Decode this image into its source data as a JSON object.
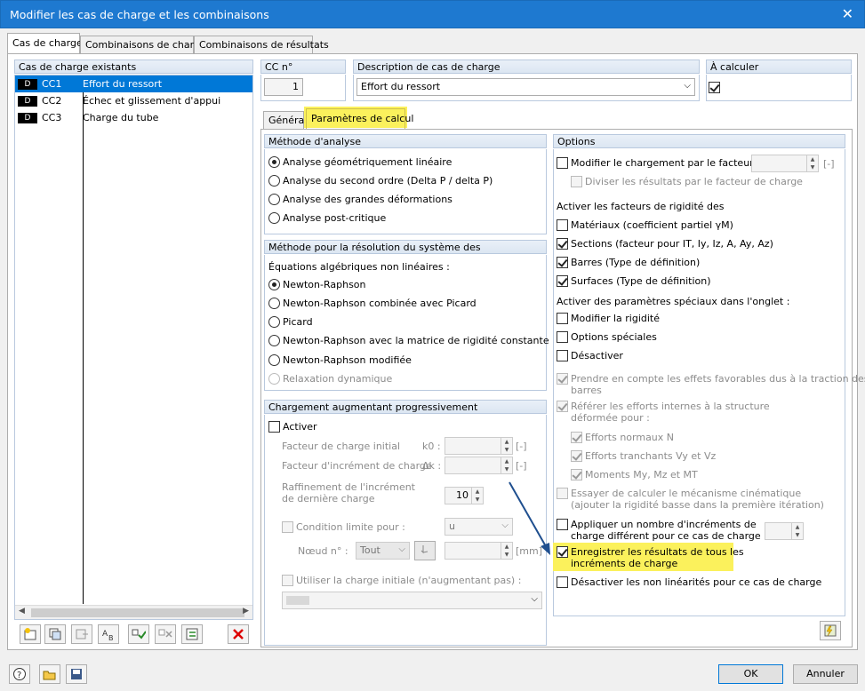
{
  "window": {
    "title": "Modifier les cas de charge et les combinaisons",
    "close": "✕"
  },
  "tabs": [
    "Cas de charge",
    "Combinaisons de charge",
    "Combinaisons de résultats"
  ],
  "list": {
    "header": "Cas de charge existants",
    "items": [
      {
        "type": "D",
        "id": "CC1",
        "name": "Effort du ressort"
      },
      {
        "type": "D",
        "id": "CC2",
        "name": "Échec et glissement d'appui"
      },
      {
        "type": "D",
        "id": "CC3",
        "name": "Charge du tube"
      }
    ]
  },
  "cc": {
    "label": "CC n°",
    "value": "1"
  },
  "desc": {
    "label": "Description de cas de charge",
    "value": "Effort du ressort"
  },
  "calc": {
    "label": "À calculer"
  },
  "subtabs": [
    "Général",
    "Paramètres de calcul"
  ],
  "analysis": {
    "title": "Méthode d'analyse",
    "options": [
      "Analyse géométriquement linéaire",
      "Analyse du second ordre (Delta P / delta P)",
      "Analyse des grandes déformations",
      "Analyse post-critique"
    ]
  },
  "solver": {
    "title": "Méthode pour la résolution du système des",
    "sub": "Équations algébriques non linéaires :",
    "options": [
      "Newton-Raphson",
      "Newton-Raphson combinée avec Picard",
      "Picard",
      "Newton-Raphson avec la matrice de rigidité constante",
      "Newton-Raphson modifiée",
      "Relaxation dynamique"
    ]
  },
  "prog": {
    "title": "Chargement augmentant progressivement",
    "activate": "Activer",
    "f1": "Facteur de charge initial",
    "f1s": "k0 :",
    "f2": "Facteur d'incrément de charge",
    "f2s": "Δk :",
    "unit": "[-]",
    "refine": "Raffinement de l'incrément de dernière charge",
    "refine_val": "10",
    "cond": "Condition limite pour :",
    "cond_val": "u",
    "node": "Nœud n° :",
    "node_val": "Tout",
    "mm": "[mm]",
    "initial": "Utiliser la charge initiale (n'augmentant pas) :"
  },
  "options": {
    "title": "Options",
    "modify": "Modifier le chargement par le facteur :",
    "unit": "[-]",
    "divide": "Diviser les résultats par le facteur de charge",
    "rig_head": "Activer les facteurs de rigidité des",
    "materials": "Matériaux (coefficient partiel γM)",
    "sections": "Sections (facteur pour IT, Iy, Iz, A, Ay, Az)",
    "bars": "Barres (Type de définition)",
    "surfaces": "Surfaces (Type de définition)",
    "spec_head": "Activer des paramètres spéciaux dans l'onglet :",
    "modrig": "Modifier la rigidité",
    "specopt": "Options spéciales",
    "deact": "Désactiver",
    "favorable1": "Prendre en compte les effets favorables dus à la traction des",
    "favorable2": "barres",
    "ref1": "Référer les efforts internes à la structure",
    "ref2": "déformée pour :",
    "normal": "Efforts normaux N",
    "shear": "Efforts tranchants Vy et Vz",
    "moments": "Moments My, Mz et MT",
    "mech1": "Essayer de calculer le mécanisme cinématique",
    "mech2": "(ajouter la rigidité basse dans la première itération)",
    "apply1": "Appliquer un nombre d'incréments de",
    "apply2": "charge différent pour ce cas de charge :",
    "save1": "Enregistrer les résultats de tous les",
    "save2": "incréments de charge",
    "nonlin": "Désactiver les non linéarités pour ce cas de charge"
  },
  "buttons": {
    "ok": "OK",
    "cancel": "Annuler"
  },
  "colors": {
    "titlebar": "#1e79d0",
    "highlight": "#fbf15c",
    "selection": "#0078d7"
  }
}
